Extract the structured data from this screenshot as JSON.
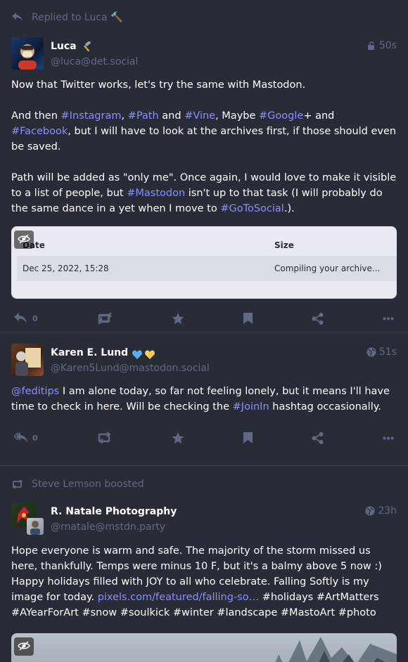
{
  "posts": [
    {
      "prepend": "Replied to Luca 🔨",
      "display_name": "Luca",
      "acct": "@luca@det.social",
      "time": "50s",
      "content_p1": "Now that Twitter works, let's try the same with Mastodon.",
      "p2": {
        "t1": "And then ",
        "h1": "#Instagram",
        "t2": ", ",
        "h2": "#Path",
        "t3": " and ",
        "h3": "#Vine",
        "t4": ", Maybe ",
        "h4": "#Google",
        "t5": "+ and ",
        "h5": "#Facebook",
        "t6": ", but I will have to look at the archives first, if those should even be saved."
      },
      "p3": {
        "t1": "Path will be added as \"only me\". Once again, I would love to make it visible to a list of people, but ",
        "h1": "#Mastodon",
        "t2": " isn't up to that task (I will probably do the same dance in a yet when I move to ",
        "h2": "#GoToSocial",
        "t3": ".)."
      },
      "archive": {
        "col_date": "Date",
        "col_size": "Size",
        "row_date": "Dec 25, 2022, 15:28",
        "row_size": "Compiling your archive..."
      },
      "reply_count": "0"
    },
    {
      "display_name": "Karen E. Lund",
      "acct": "@Karen5Lund@mastodon.social",
      "time": "51s",
      "content": {
        "m1": "@feditips",
        "t1": " I am alone today, so far not feeling lonely, but it means I'll have time to check in here. Will be checking the ",
        "h1": "#JoinIn",
        "t2": " hashtag occasionally."
      },
      "reply_count": "0"
    },
    {
      "prepend": "Steve Lemson boosted",
      "display_name": "R. Natale Photography",
      "acct": "@rnatale@mstdn.party",
      "time": "23h",
      "content": {
        "t1": "Hope everyone is warm and safe. The majority of the storm missed us here, thankfully. Temps were minus 10 F, but it's a balmy above 5 now :) Happy holidays filled with JOY to all who celebrate. Falling Softly is my image for today. ",
        "link": "pixels.com/featured/falling-so…",
        "tags": " #holidays #ArtMatters #AYearForArt #snow #soulkick #winter #landscape #MastoArt #photo"
      }
    }
  ],
  "colors": {
    "background": "#282c37",
    "muted": "#606984",
    "hashtag": "#8c8dff"
  },
  "icons": [
    "reply-icon",
    "boost-icon",
    "star-icon",
    "bookmark-icon",
    "share-icon",
    "more-icon",
    "eye-slash-icon",
    "lock-icon",
    "globe-icon"
  ]
}
